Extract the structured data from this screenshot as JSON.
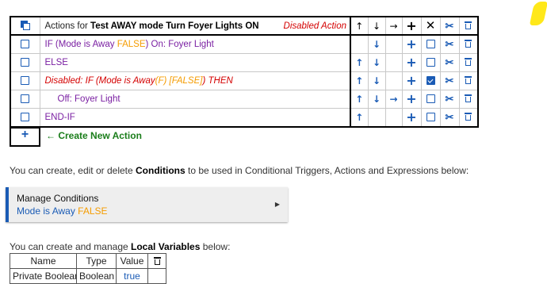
{
  "actions_table": {
    "header": {
      "title_prefix": "Actions for ",
      "title_name": "Test AWAY mode Turn Foyer Lights ON",
      "status": "Disabled Action",
      "col_up": "↑",
      "col_down": "↓",
      "col_right": "→",
      "col_add": "+",
      "col_delete": "✕"
    },
    "rows": [
      {
        "pre": "IF (Mode is Away ",
        "flag": "FALSE",
        "post": ") On: Foyer Light",
        "up": "",
        "down": "↓",
        "right": "",
        "checked": false
      },
      {
        "pre": "ELSE",
        "flag": "",
        "post": "",
        "up": "↑",
        "down": "↓",
        "right": "",
        "checked": false
      },
      {
        "pre": "Disabled: IF (Mode is Away",
        "flag": "(F) [FALSE]",
        "post": ") THEN",
        "up": "↑",
        "down": "↓",
        "right": "",
        "checked": true
      },
      {
        "pre": "Off: Foyer Light",
        "flag": "",
        "post": "",
        "up": "↑",
        "down": "↓",
        "right": "→",
        "checked": false
      },
      {
        "pre": "END-IF",
        "flag": "",
        "post": "",
        "up": "↑",
        "down": "",
        "right": "",
        "checked": false
      }
    ],
    "add_symbol": "+"
  },
  "create_action": {
    "symbol": "+",
    "arrow": "←",
    "label": "Create New Action"
  },
  "conditions_intro": {
    "pre": "You can create, edit or delete ",
    "bold": "Conditions",
    "post": " to be used in Conditional Triggers, Actions and Expressions below:"
  },
  "manage_conditions": {
    "title": "Manage Conditions",
    "condition_name": "Mode is Away ",
    "condition_value": "FALSE",
    "caret": "▶"
  },
  "locals_intro": {
    "pre": "You can create and manage ",
    "bold": "Local Variables",
    "post": " below:"
  },
  "variables_table": {
    "headers": [
      "Name",
      "Type",
      "Value"
    ],
    "rows": [
      {
        "name": "Private Boolean",
        "type": "Boolean",
        "value": "true"
      }
    ]
  },
  "colors": {
    "accent": "#1a5bb5",
    "purple": "#7a1fa2",
    "orange": "#f59c00",
    "red": "#d40000",
    "green": "#1a7d1a",
    "highlight": "#ffe81a"
  }
}
